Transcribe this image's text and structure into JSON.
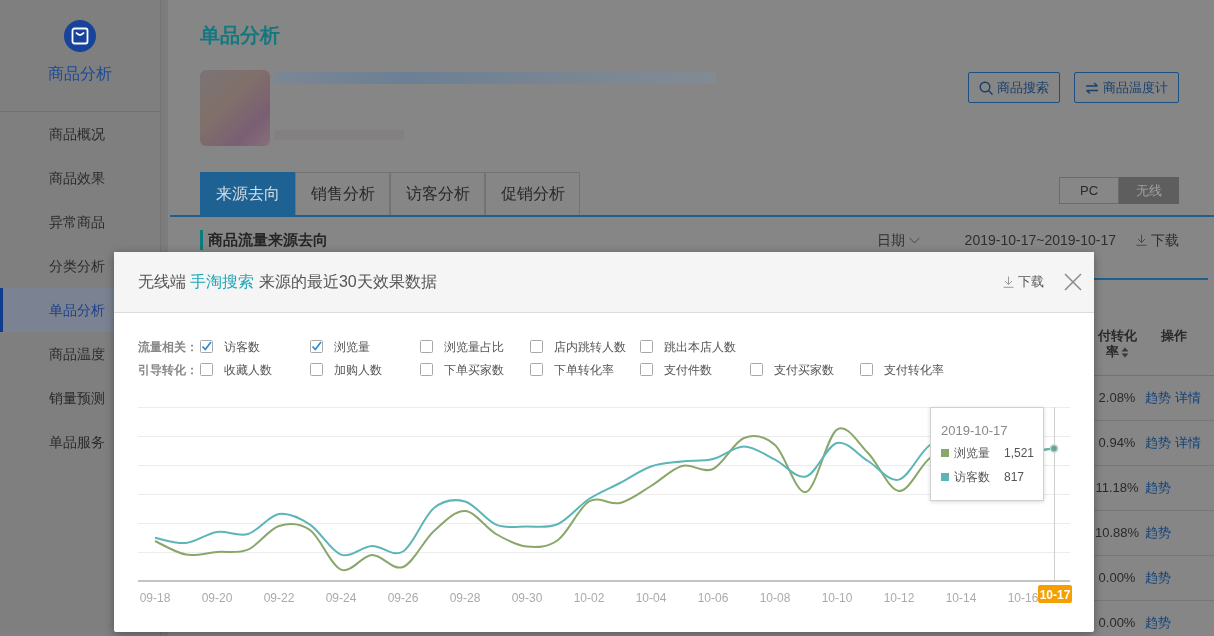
{
  "sidebar": {
    "title": "商品分析",
    "items": [
      {
        "label": "商品概况",
        "selected": false
      },
      {
        "label": "商品效果",
        "selected": false
      },
      {
        "label": "异常商品",
        "selected": false
      },
      {
        "label": "分类分析",
        "selected": false
      },
      {
        "label": "单品分析",
        "selected": true
      },
      {
        "label": "商品温度",
        "selected": false
      },
      {
        "label": "销量预测",
        "selected": false
      },
      {
        "label": "单品服务",
        "selected": false
      }
    ]
  },
  "page": {
    "title": "单品分析",
    "actions": [
      {
        "label": "商品搜索",
        "kind": "search"
      },
      {
        "label": "商品温度计",
        "kind": "swap"
      }
    ]
  },
  "tabs": [
    {
      "label": "来源去向",
      "selected": true
    },
    {
      "label": "销售分析",
      "selected": false
    },
    {
      "label": "访客分析",
      "selected": false
    },
    {
      "label": "促销分析",
      "selected": false
    }
  ],
  "device_toggle": [
    {
      "label": "PC",
      "selected": false
    },
    {
      "label": "无线",
      "selected": true
    }
  ],
  "section": {
    "title": "商品流量来源去向",
    "date_label": "日期",
    "date_range": "2019-10-17~2019-10-17",
    "download": "下载"
  },
  "table": {
    "columns": [
      {
        "label": "付转化率",
        "sortable": true
      },
      {
        "label": "操作",
        "sortable": false
      }
    ],
    "rows": [
      {
        "rate": "2.08%",
        "actions": [
          "趋势",
          "详情"
        ]
      },
      {
        "rate": "0.94%",
        "actions": [
          "趋势",
          "详情"
        ]
      },
      {
        "rate": "11.18%",
        "actions": [
          "趋势"
        ]
      },
      {
        "rate": "10.88%",
        "actions": [
          "趋势"
        ]
      },
      {
        "rate": "0.00%",
        "actions": [
          "趋势"
        ]
      },
      {
        "rate": "0.00%",
        "actions": [
          "趋势"
        ]
      }
    ]
  },
  "modal": {
    "title": {
      "prefix": "无线端",
      "source": "手淘搜索",
      "suffix": "来源的最近30天效果数据"
    },
    "download": "下载",
    "metric_groups": [
      {
        "label": "流量相关：",
        "options": [
          {
            "label": "访客数",
            "checked": true
          },
          {
            "label": "浏览量",
            "checked": true
          },
          {
            "label": "浏览量占比",
            "checked": false
          },
          {
            "label": "店内跳转人数",
            "checked": false
          },
          {
            "label": "跳出本店人数",
            "checked": false
          }
        ]
      },
      {
        "label": "引导转化：",
        "options": [
          {
            "label": "收藏人数",
            "checked": false
          },
          {
            "label": "加购人数",
            "checked": false
          },
          {
            "label": "下单买家数",
            "checked": false
          },
          {
            "label": "下单转化率",
            "checked": false
          },
          {
            "label": "支付件数",
            "checked": false
          },
          {
            "label": "支付买家数",
            "checked": false
          },
          {
            "label": "支付转化率",
            "checked": false
          }
        ]
      }
    ],
    "chart": {
      "x_labels": [
        "09-18",
        "09-20",
        "09-22",
        "09-24",
        "09-26",
        "09-28",
        "09-30",
        "10-02",
        "10-04",
        "10-06",
        "10-08",
        "10-10",
        "10-12",
        "10-14",
        "10-16"
      ],
      "highlight_label": "10-17",
      "tooltip": {
        "title": "2019-10-17",
        "items": [
          {
            "label": "浏览量",
            "value": "1,521",
            "color": "#8aa76b"
          },
          {
            "label": "访客数",
            "value": "817",
            "color": "#5db5b7"
          }
        ]
      }
    }
  }
}
